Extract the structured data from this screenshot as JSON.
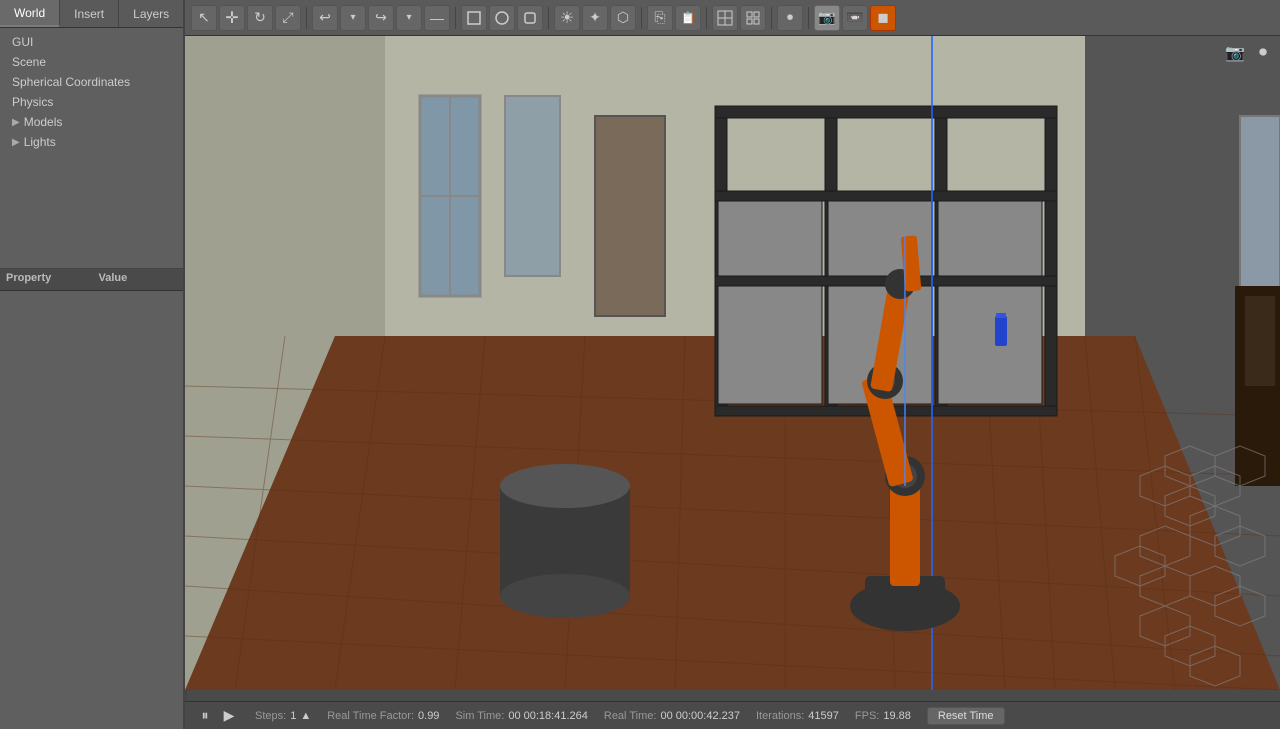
{
  "tabs": [
    {
      "label": "World",
      "active": true
    },
    {
      "label": "Insert",
      "active": false
    },
    {
      "label": "Layers",
      "active": false
    }
  ],
  "sidebar": {
    "items": [
      {
        "label": "GUI",
        "hasArrow": false
      },
      {
        "label": "Scene",
        "hasArrow": false
      },
      {
        "label": "Spherical Coordinates",
        "hasArrow": false
      },
      {
        "label": "Physics",
        "hasArrow": false
      },
      {
        "label": "Models",
        "hasArrow": true
      },
      {
        "label": "Lights",
        "hasArrow": true
      }
    ]
  },
  "property_panel": {
    "col1": "Property",
    "col2": "Value"
  },
  "toolbar": {
    "buttons": [
      {
        "name": "select-tool",
        "icon": "↖",
        "tooltip": "Select"
      },
      {
        "name": "translate-tool",
        "icon": "✛",
        "tooltip": "Translate"
      },
      {
        "name": "rotate-tool",
        "icon": "↻",
        "tooltip": "Rotate"
      },
      {
        "name": "scale-tool",
        "icon": "⤢",
        "tooltip": "Scale"
      },
      {
        "name": "undo",
        "icon": "↩",
        "tooltip": "Undo"
      },
      {
        "name": "redo",
        "icon": "↪",
        "tooltip": "Redo"
      },
      {
        "name": "sep1"
      },
      {
        "name": "box-shape",
        "icon": "□",
        "tooltip": "Box"
      },
      {
        "name": "sphere-shape",
        "icon": "○",
        "tooltip": "Sphere"
      },
      {
        "name": "cylinder-shape",
        "icon": "⬜",
        "tooltip": "Cylinder"
      },
      {
        "name": "sun-light",
        "icon": "☀",
        "tooltip": "Sun light"
      },
      {
        "name": "point-light",
        "icon": "✦",
        "tooltip": "Point light"
      },
      {
        "name": "spot-light",
        "icon": "⬡",
        "tooltip": "Spot light"
      },
      {
        "name": "sep2"
      },
      {
        "name": "copy",
        "icon": "⎘",
        "tooltip": "Copy"
      },
      {
        "name": "paste",
        "icon": "📋",
        "tooltip": "Paste"
      },
      {
        "name": "sep3"
      },
      {
        "name": "wireframe",
        "icon": "⊞",
        "tooltip": "Wireframe"
      },
      {
        "name": "grid",
        "icon": "▦",
        "tooltip": "Grid"
      },
      {
        "name": "sep4"
      },
      {
        "name": "record",
        "icon": "⏺",
        "tooltip": "Record"
      },
      {
        "name": "screenshot",
        "icon": "📷",
        "tooltip": "Screenshot"
      },
      {
        "name": "orange-tool",
        "icon": "◼",
        "tooltip": "Tool"
      }
    ]
  },
  "status_bar": {
    "pause_icon": "⏸",
    "step_icon": "▶",
    "steps_label": "Steps:",
    "steps_value": "1",
    "realtime_factor_label": "Real Time Factor:",
    "realtime_factor_value": "0.99",
    "simtime_label": "Sim Time:",
    "simtime_value": "00 00:18:41.264",
    "realtime_label": "Real Time:",
    "realtime_value": "00 00:00:42.237",
    "iterations_label": "Iterations:",
    "iterations_value": "41597",
    "fps_label": "FPS:",
    "fps_value": "19.88",
    "reset_btn": "Reset Time"
  },
  "viewport_icons": [
    {
      "name": "screenshot-icon",
      "icon": "📷"
    },
    {
      "name": "record-icon",
      "icon": "⏺"
    }
  ],
  "scene": {
    "bg_color": "#888888",
    "floor_color": "#7a4a2a",
    "wall_color": "#b0b0a0",
    "robot_color": "#cc5500"
  }
}
